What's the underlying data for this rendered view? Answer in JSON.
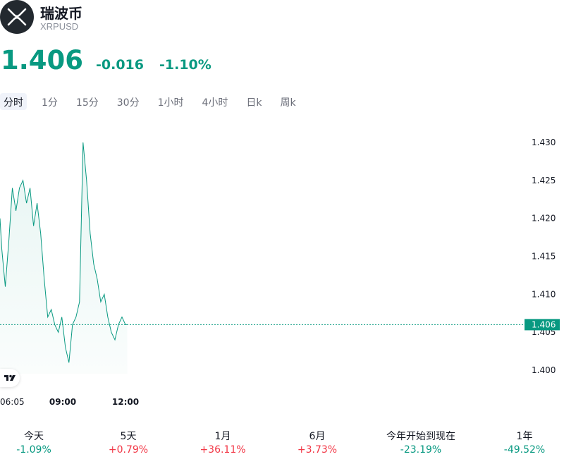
{
  "header": {
    "name": "瑞波币",
    "ticker": "XRPUSD",
    "price": "1.406",
    "change": "-0.016",
    "change_pct": "-1.10%"
  },
  "tabs": [
    "分时",
    "1分",
    "15分",
    "30分",
    "1小时",
    "4小时",
    "日k",
    "周k"
  ],
  "active_tab": "分时",
  "colors": {
    "line": "#089981",
    "up": "#f23645",
    "down": "#089981"
  },
  "icons": {
    "logo": "xrp-logo-icon",
    "brand": "tradingview-logo-icon"
  },
  "chart_data": {
    "type": "area",
    "ylim": [
      1.399,
      1.431
    ],
    "yticks": [
      "1.430",
      "1.425",
      "1.420",
      "1.415",
      "1.410",
      "1.405",
      "1.400"
    ],
    "xticks": [
      "06:05",
      "09:00",
      "12:00"
    ],
    "last_price_label": "1.406",
    "series": [
      {
        "x": [
          "06:05",
          "06:10",
          "06:20",
          "06:30",
          "06:40",
          "06:50",
          "07:00",
          "07:10",
          "07:20",
          "07:30",
          "07:40",
          "07:50",
          "08:00",
          "08:10",
          "08:20",
          "08:30",
          "08:40",
          "08:50",
          "09:00",
          "09:10",
          "09:20",
          "09:30",
          "09:40",
          "09:50",
          "10:00",
          "10:10",
          "10:20",
          "10:30",
          "10:40",
          "10:50",
          "11:00",
          "11:10",
          "11:20",
          "11:30",
          "11:40",
          "11:50",
          "12:00",
          "12:05"
        ],
        "values": [
          1.42,
          1.416,
          1.411,
          1.417,
          1.424,
          1.421,
          1.424,
          1.425,
          1.422,
          1.424,
          1.419,
          1.422,
          1.418,
          1.412,
          1.407,
          1.408,
          1.406,
          1.405,
          1.407,
          1.403,
          1.401,
          1.406,
          1.407,
          1.409,
          1.43,
          1.425,
          1.418,
          1.414,
          1.412,
          1.409,
          1.41,
          1.407,
          1.405,
          1.404,
          1.406,
          1.407,
          1.406,
          1.406
        ]
      }
    ]
  },
  "performance": [
    {
      "label": "今天",
      "value": "-1.09%",
      "dir": "down"
    },
    {
      "label": "5天",
      "value": "+0.79%",
      "dir": "up"
    },
    {
      "label": "1月",
      "value": "+36.11%",
      "dir": "up"
    },
    {
      "label": "6月",
      "value": "+3.73%",
      "dir": "up"
    },
    {
      "label": "今年开始到现在",
      "value": "-23.19%",
      "dir": "down"
    },
    {
      "label": "1年",
      "value": "-49.52%",
      "dir": "down"
    }
  ]
}
